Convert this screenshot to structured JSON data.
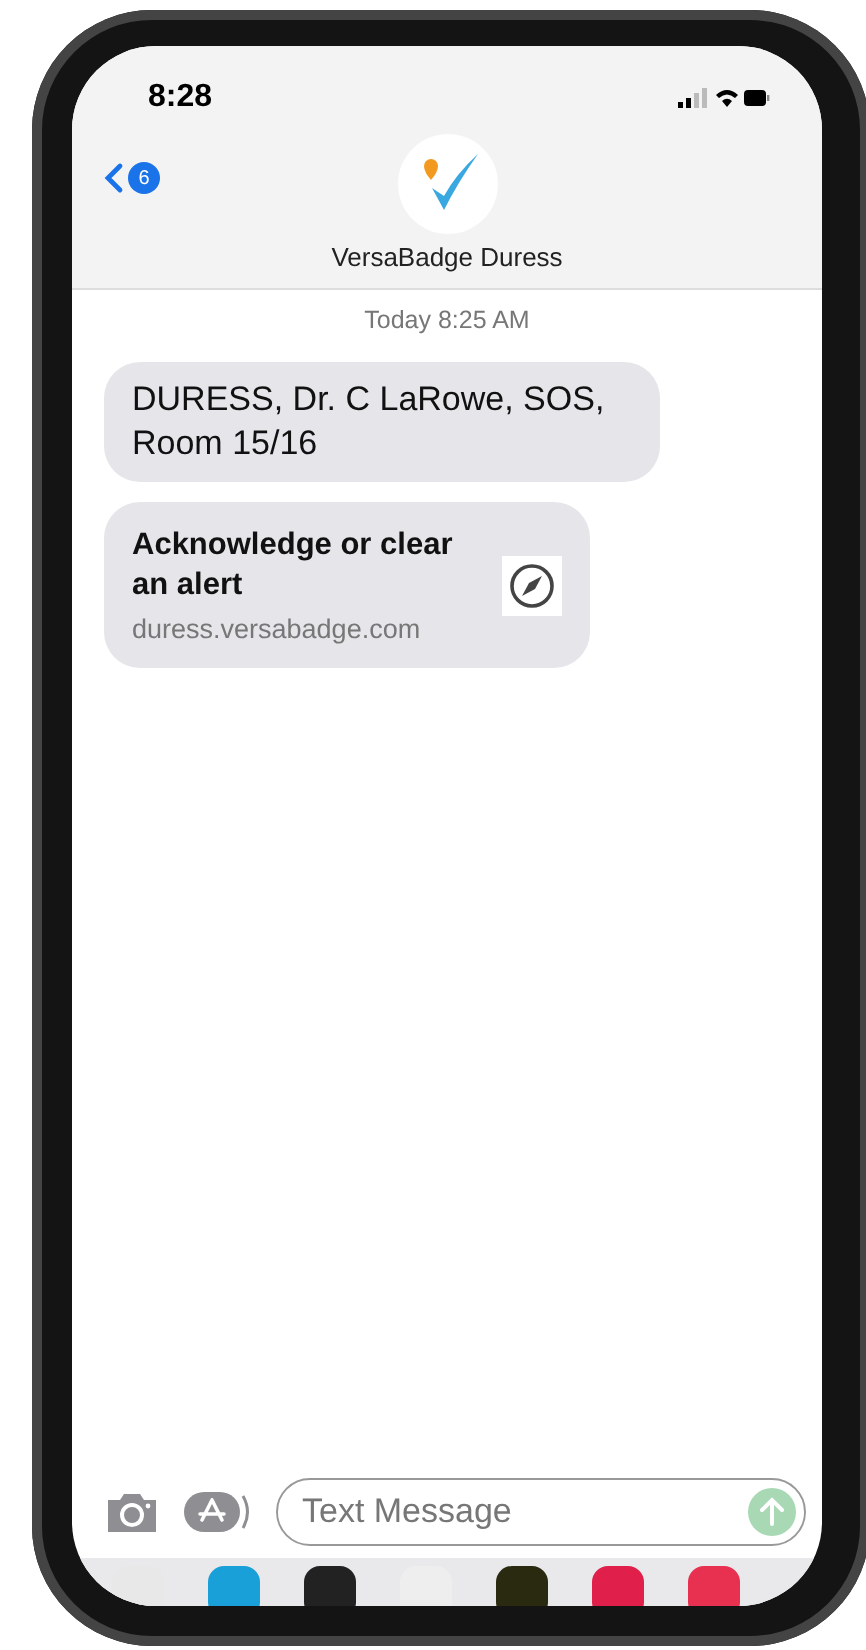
{
  "status_bar": {
    "time": "8:28"
  },
  "nav": {
    "back_count": "6",
    "contact_name": "VersaBadge Duress"
  },
  "timestamp": "Today 8:25 AM",
  "messages": [
    {
      "kind": "text",
      "text": "DURESS, Dr. C LaRowe, SOS, Room 15/16"
    },
    {
      "kind": "link",
      "title": "Acknowledge or clear an alert",
      "url": "duress.versabadge.com"
    }
  ],
  "composer": {
    "placeholder": "Text Message"
  }
}
